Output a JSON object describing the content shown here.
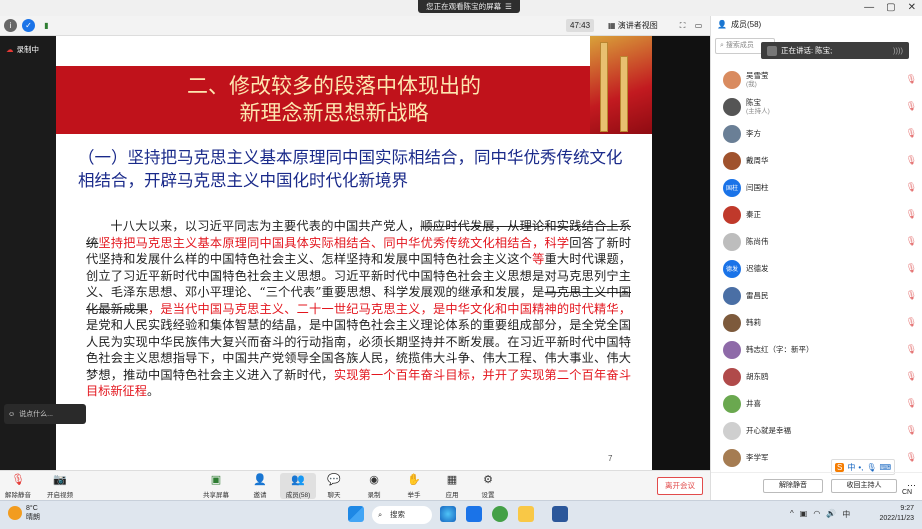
{
  "window": {
    "sharing_banner": "您正在观看陈宝的屏幕"
  },
  "toolbar": {
    "timer": "47:43",
    "view_mode": "演讲者视图"
  },
  "recording": {
    "label": "录制中"
  },
  "slide": {
    "banner_line1": "二、修改较多的段落中体现出的",
    "banner_line2": "新理念新思想新战略",
    "heading": "（一）坚持把马克思主义基本原理同中国实际相结合，同中华优秀传统文化相结合，开辟马克思主义中国化时代化新境界",
    "body": [
      {
        "t": "十八大以来，以习近平同志为主要代表的中国共产党人，",
        "s": "n"
      },
      {
        "t": "顺应时代发展，从理论和实践结合上系统",
        "s": "d"
      },
      {
        "t": "坚持把马克思主义基本原理同中国具体实际相结合、同中华优秀传统文化相结合，科学",
        "s": "r"
      },
      {
        "t": "回答了新时代坚持和发展什么样的中国特色社会主义、怎样坚持和发展中国特色社会主义这个",
        "s": "n"
      },
      {
        "t": "等",
        "s": "r"
      },
      {
        "t": "重大时代课题，创立了习近平新时代中国特色社会主义思想。习近平新时代中国特色社会主义思想是对马克思列宁主义、毛泽东思想、邓小平理论、“三个代表”重要思想、科学发展观的继承和发展，是",
        "s": "n"
      },
      {
        "t": "马克思主义中国化最新成果",
        "s": "d"
      },
      {
        "t": "，是当代中国马克思主义、二十一世纪马克思主义，是中华文化和中国精神的时代精华，",
        "s": "r"
      },
      {
        "t": "是党和人民实践经验和集体智慧的结晶，是中国特色社会主义理论体系的重要组成部分，是全党全国人民为实现中华民族伟大复兴而奋斗的行动指南，必须长期坚持并不断发展。在习近平新时代中国特色社会主义思想指导下，中国共产党领导全国各族人民，统揽伟大斗争、伟大工程、伟大事业、伟大梦想，推动中国特色社会主义进入了新时代，",
        "s": "n"
      },
      {
        "t": "实现第一个百年奋斗目标，并开了实现第二个百年奋斗目标新征程",
        "s": "r"
      },
      {
        "t": "。",
        "s": "n"
      }
    ],
    "page_number": "7"
  },
  "chat": {
    "placeholder": "说点什么..."
  },
  "bottom_toolbar": {
    "unmute": "解除静音",
    "video": "开启视频",
    "share": "共享屏幕",
    "invite": "邀请",
    "members": "成员(58)",
    "chat": "聊天",
    "record": "录制",
    "raise_hand": "举手",
    "apps": "应用",
    "settings": "设置",
    "leave": "离开会议"
  },
  "panel": {
    "title": "成员(58)",
    "search_placeholder": "搜索成员",
    "speaking": "正在讲话: 陈宝;",
    "members": [
      {
        "name": "吴雪莹",
        "sub": "(我)",
        "color": "#d98b5f"
      },
      {
        "name": "陈宝",
        "sub": "(主持人)",
        "color": "#555555"
      },
      {
        "name": "李方",
        "sub": "",
        "color": "#6a7f96"
      },
      {
        "name": "戴周华",
        "sub": "",
        "color": "#a0522d"
      },
      {
        "name": "闫国柱",
        "sub": "",
        "color": "#1a73e8",
        "initials": "国柱"
      },
      {
        "name": "秦正",
        "sub": "",
        "color": "#c0392b"
      },
      {
        "name": "陈尚伟",
        "sub": "",
        "color": "#bdbdbd"
      },
      {
        "name": "迟德发",
        "sub": "",
        "color": "#1a73e8",
        "initials": "德发"
      },
      {
        "name": "雷昌民",
        "sub": "",
        "color": "#4a6fa5"
      },
      {
        "name": "韩莉",
        "sub": "",
        "color": "#7d5a3c"
      },
      {
        "name": "韩志红（字：新平）",
        "sub": "",
        "color": "#8e6aa8"
      },
      {
        "name": "胡东鸥",
        "sub": "",
        "color": "#b04a4a"
      },
      {
        "name": "井喜",
        "sub": "",
        "color": "#6aa84f"
      },
      {
        "name": "开心就是幸福",
        "sub": "",
        "color": "#cfcfcf"
      },
      {
        "name": "李学军",
        "sub": "",
        "color": "#a57c52"
      }
    ],
    "unmute_all": "解除静音",
    "reclaim_host": "收回主持人"
  },
  "ime": {
    "label": "中"
  },
  "taskbar": {
    "temperature": "8°C",
    "weather": "晴朗",
    "search": "搜索",
    "time": "9:27",
    "date": "2022/11/23",
    "lang": "CN"
  }
}
